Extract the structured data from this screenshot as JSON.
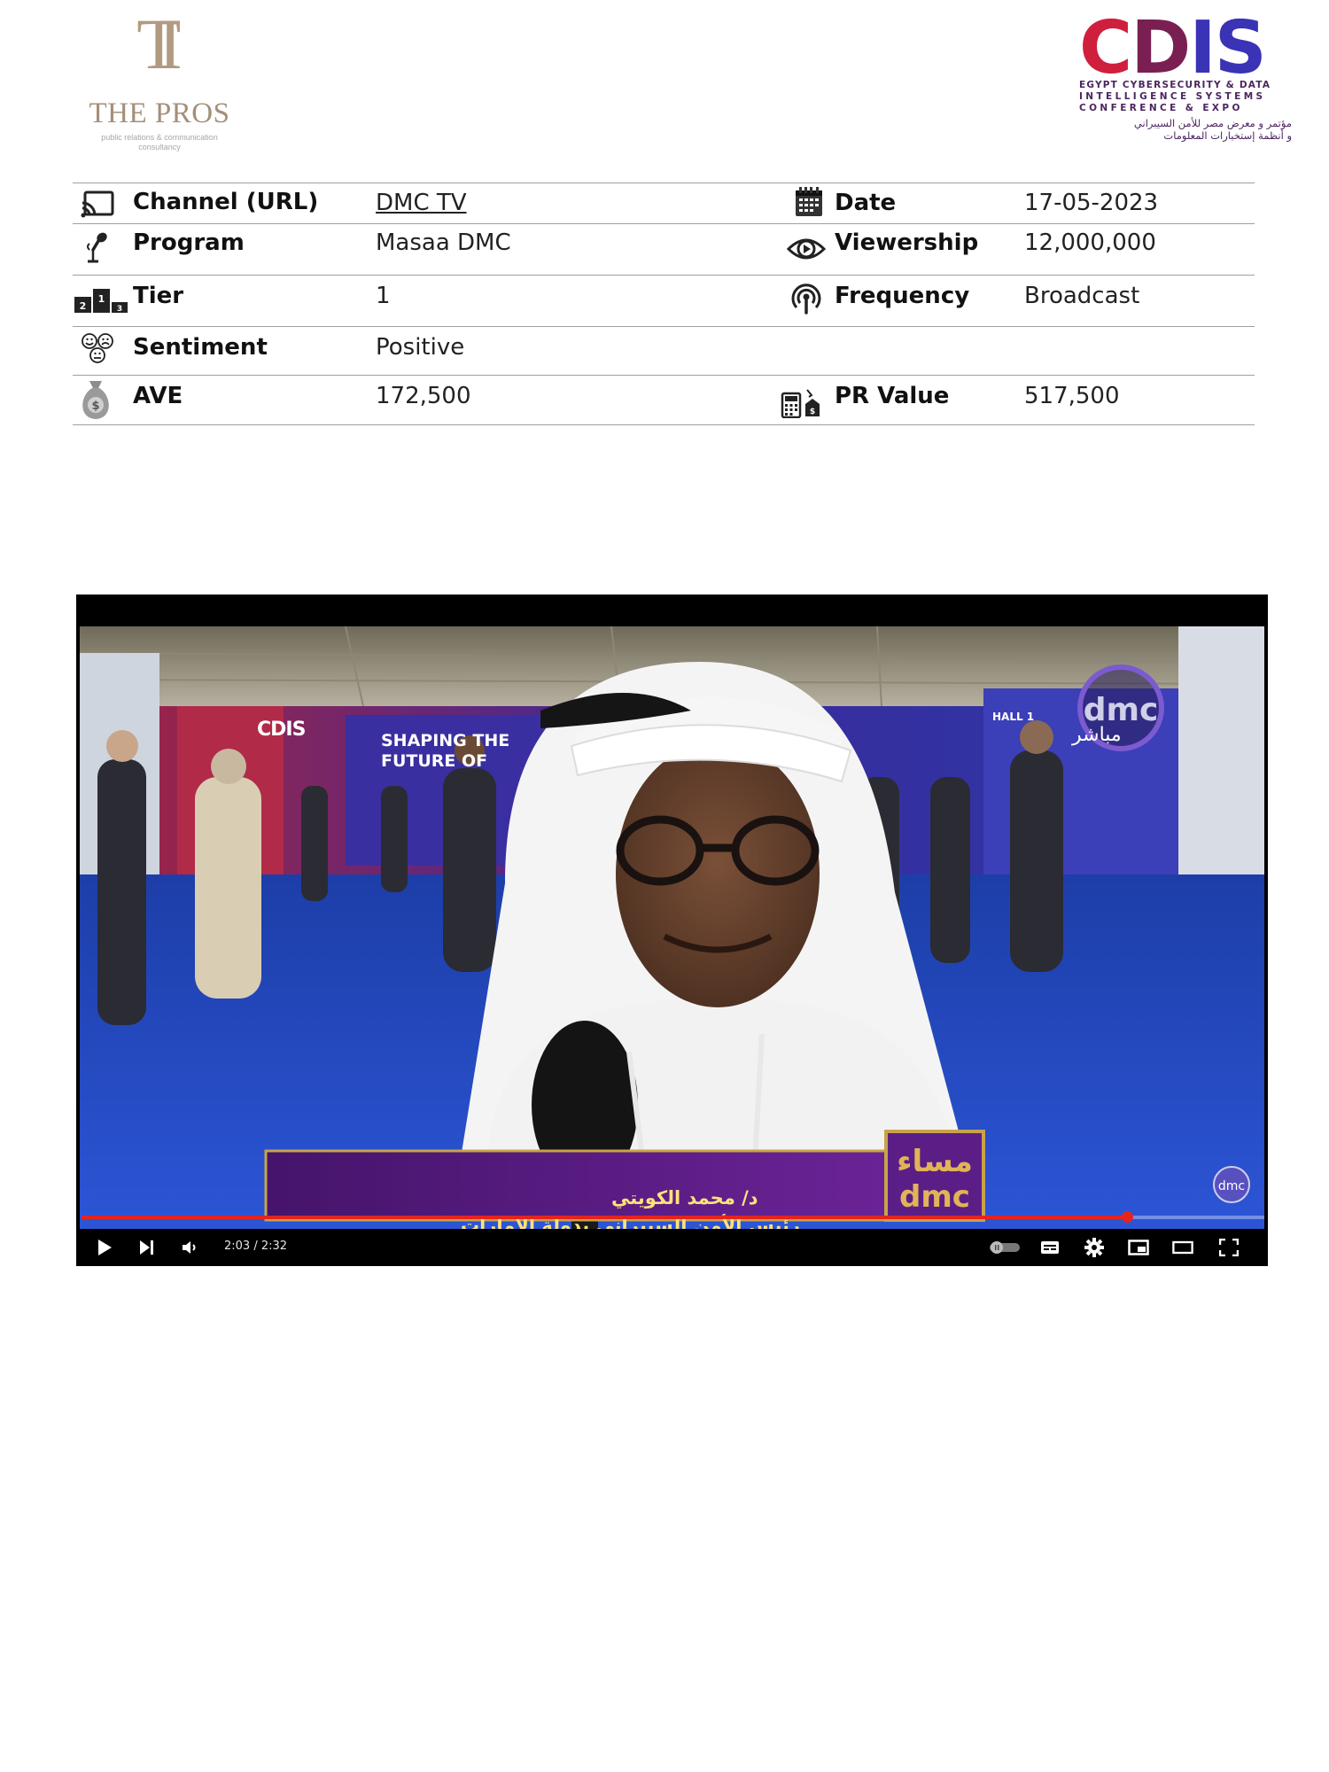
{
  "header": {
    "left_logo": {
      "mark": "TI",
      "name": "THE PROS",
      "tagline": "public relations & communication consultancy"
    },
    "right_logo": {
      "wordmark": {
        "c": "C",
        "d": "D",
        "is": "IS"
      },
      "line1": "EGYPT CYBERSECURITY & DATA",
      "line2": "INTELLIGENCE SYSTEMS",
      "line3": "CONFERENCE & EXPO",
      "arabic1": "مؤتمر و معرض مصر للأمن السيبراني",
      "arabic2": "و أنظمة إستخبارات المعلومات"
    }
  },
  "info": {
    "channel": {
      "label": "Channel (URL)",
      "value": "DMC TV",
      "icon": "cast-icon"
    },
    "program": {
      "label": "Program",
      "value": "Masaa DMC",
      "icon": "microphone-icon"
    },
    "tier": {
      "label": "Tier",
      "value": "1",
      "icon": "podium-icon"
    },
    "sentiment": {
      "label": "Sentiment",
      "value": "Positive",
      "icon": "faces-icon"
    },
    "ave": {
      "label": "AVE",
      "value": "172,500",
      "icon": "money-bag-icon"
    },
    "date": {
      "label": "Date",
      "value": "17-05-2023",
      "icon": "calendar-icon"
    },
    "viewership": {
      "label": "Viewership",
      "value": "12,000,000",
      "icon": "eye-icon"
    },
    "frequency": {
      "label": "Frequency",
      "value": "Broadcast",
      "icon": "broadcast-icon"
    },
    "pr_value": {
      "label": "PR Value",
      "value": "517,500",
      "icon": "calculator-icon"
    }
  },
  "video": {
    "lower_third_name": "د/ محمد الكويتي",
    "lower_third_title": "رئيس الأمن السيبراني بدولة الإمارات",
    "channel_logo": "dmc",
    "live_label": "مباشر",
    "program_logo": {
      "arabic": "مساء",
      "latin": "dmc"
    },
    "corner_logo": "dmc",
    "scene_signs": {
      "headline": "SHAPING THE FUTURE OF",
      "hall": "HALL 1",
      "booth": "CDIS"
    },
    "time_display": "2:03 / 2:32",
    "progress": 0.8836,
    "colors": {
      "progress": "#e4241d",
      "banner": "#5b1e86",
      "banner_gold": "#c9a24a"
    }
  }
}
